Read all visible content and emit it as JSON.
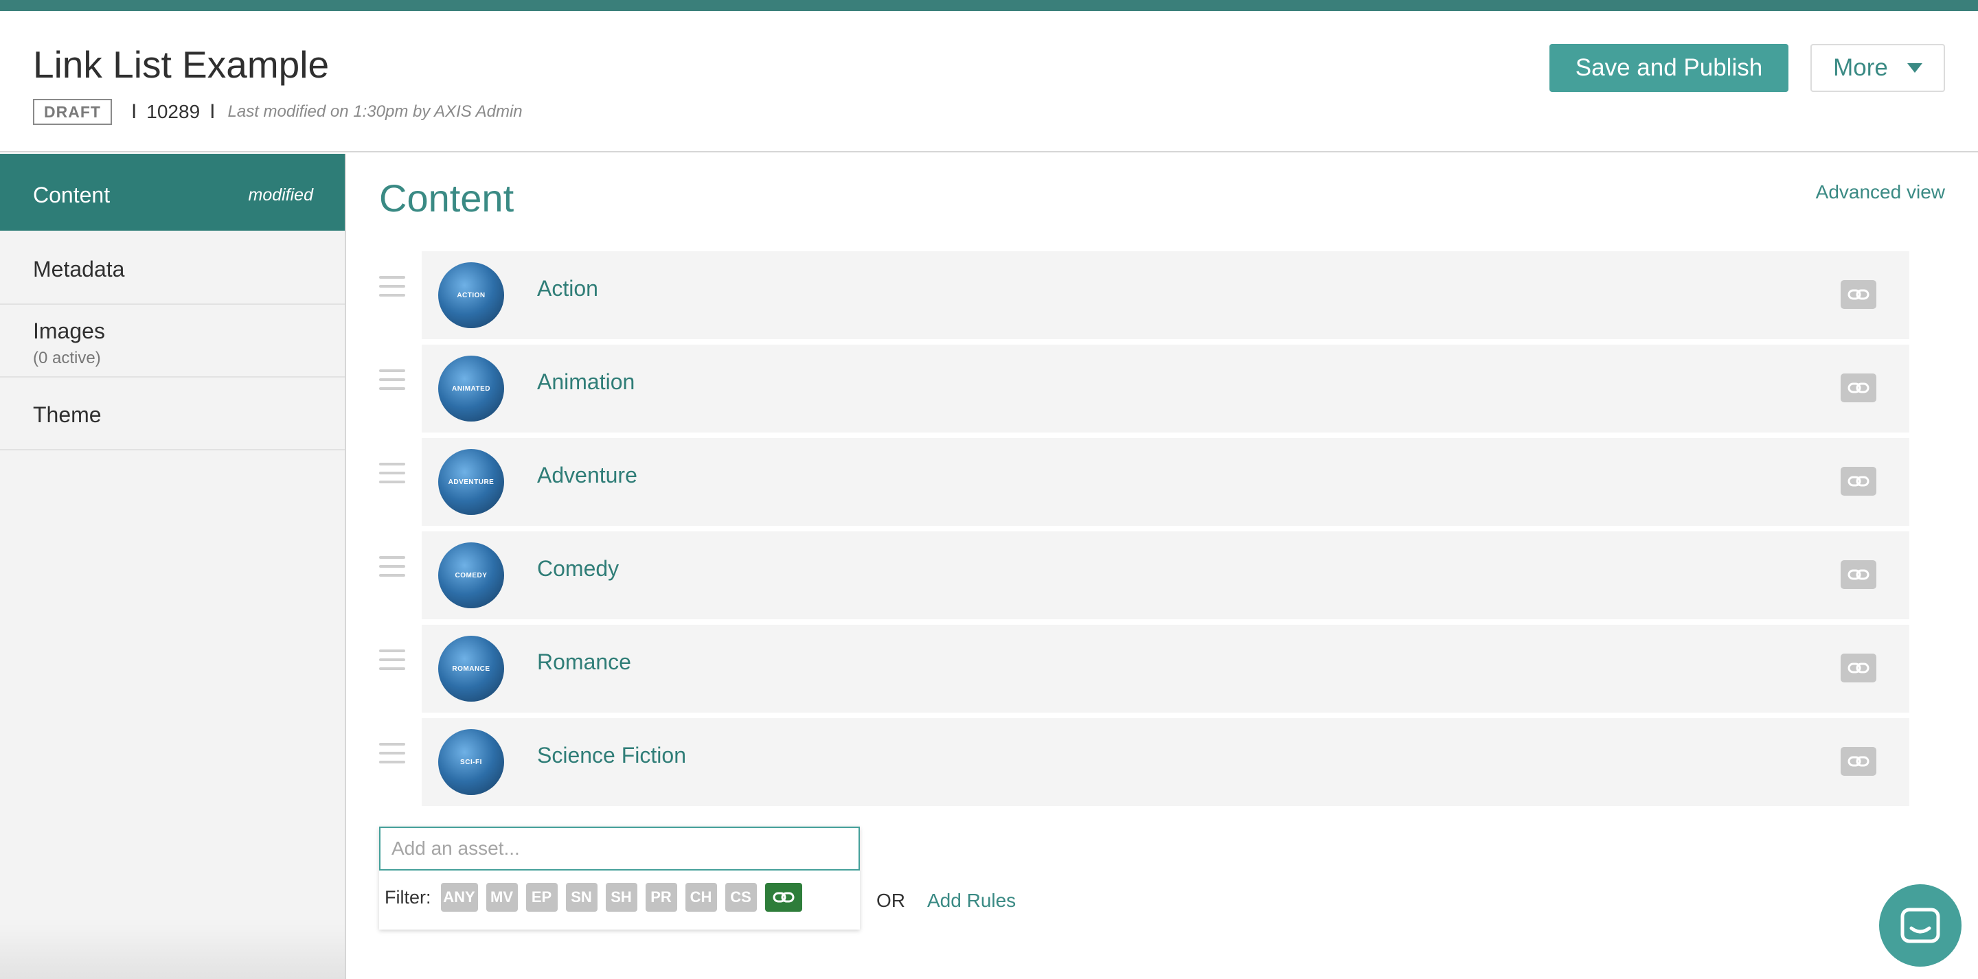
{
  "header": {
    "title": "Link List Example",
    "status_badge": "DRAFT",
    "separator": "I",
    "id": "10289",
    "last_modified": "Last modified on 1:30pm by AXIS Admin",
    "publish_label": "Save and Publish",
    "more_label": "More"
  },
  "sidebar": {
    "items": [
      {
        "label": "Content",
        "badge": "modified"
      },
      {
        "label": "Metadata"
      },
      {
        "label": "Images",
        "sub": "(0 active)"
      },
      {
        "label": "Theme"
      }
    ]
  },
  "main": {
    "title": "Content",
    "advanced_view": "Advanced view",
    "rows": [
      {
        "label": "Action",
        "thumb": "ACTION"
      },
      {
        "label": "Animation",
        "thumb": "ANIMATED"
      },
      {
        "label": "Adventure",
        "thumb": "ADVENTURE"
      },
      {
        "label": "Comedy",
        "thumb": "COMEDY"
      },
      {
        "label": "Romance",
        "thumb": "ROMANCE"
      },
      {
        "label": "Science Fiction",
        "thumb": "SCI-FI"
      }
    ]
  },
  "add_asset": {
    "placeholder": "Add an asset...",
    "filter_label": "Filter:",
    "filters": [
      "ANY",
      "MV",
      "EP",
      "SN",
      "SH",
      "PR",
      "CH",
      "CS"
    ],
    "link_filter_icon": "link-icon",
    "or_label": "OR",
    "add_rules": "Add Rules"
  },
  "colors": {
    "accent": "#45a09a",
    "accent_dark": "#2e7d77",
    "link_filter_active": "#2e7d3a"
  }
}
